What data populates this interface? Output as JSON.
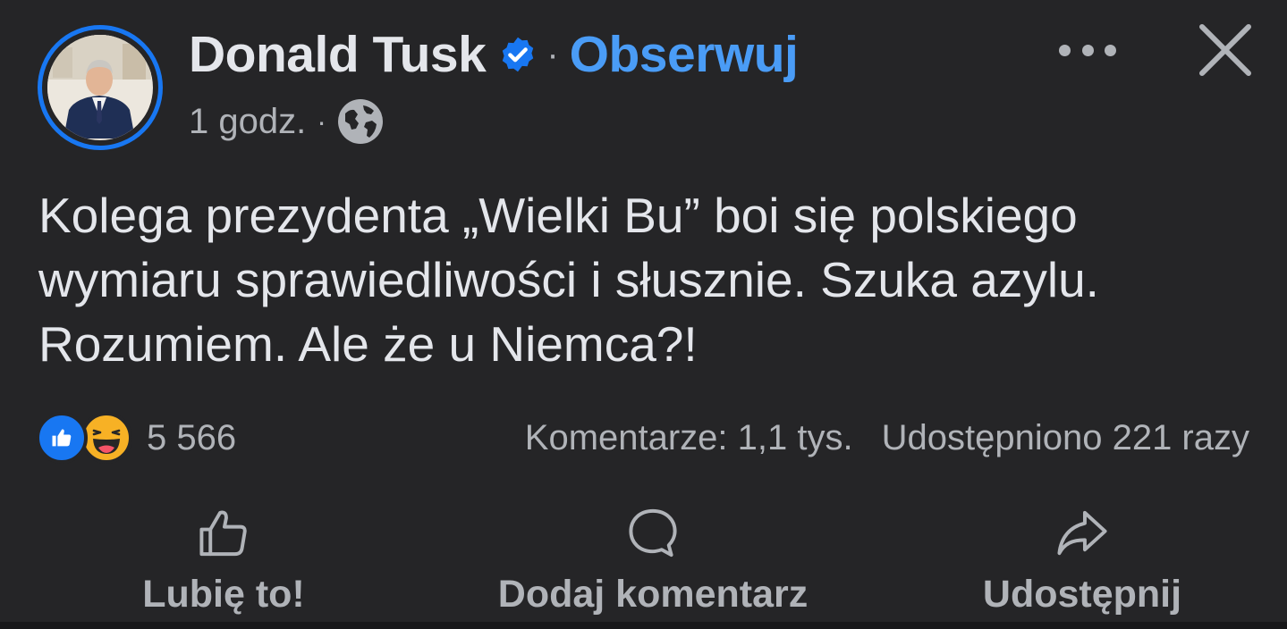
{
  "header": {
    "author_name": "Donald Tusk",
    "verified_icon": "verified-badge-icon",
    "separator": "·",
    "follow_label": "Obserwuj",
    "time": "1 godz.",
    "meta_separator": "·",
    "audience_icon": "globe-icon",
    "more_icon": "more-options-icon",
    "close_icon": "close-icon"
  },
  "post": {
    "text": "Kolega prezydenta „Wielki Bu” boi się polskiego wymiaru sprawiedliwości i słusznie. Szuka azylu. Rozumiem. Ale że u Niemca?!"
  },
  "stats": {
    "reactions": [
      "like-reaction-icon",
      "haha-reaction-icon"
    ],
    "reaction_count": "5 566",
    "comments": "Komentarze: 1,1 tys.",
    "shares": "Udostępniono 221 razy"
  },
  "actions": {
    "like_label": "Lubię to!",
    "comment_label": "Dodaj komentarz",
    "share_label": "Udostępnij"
  },
  "colors": {
    "background": "#252527",
    "accent": "#1877f2",
    "follow": "#4a9cf6",
    "text_primary": "#e4e6eb",
    "text_secondary": "#b0b3b8"
  }
}
